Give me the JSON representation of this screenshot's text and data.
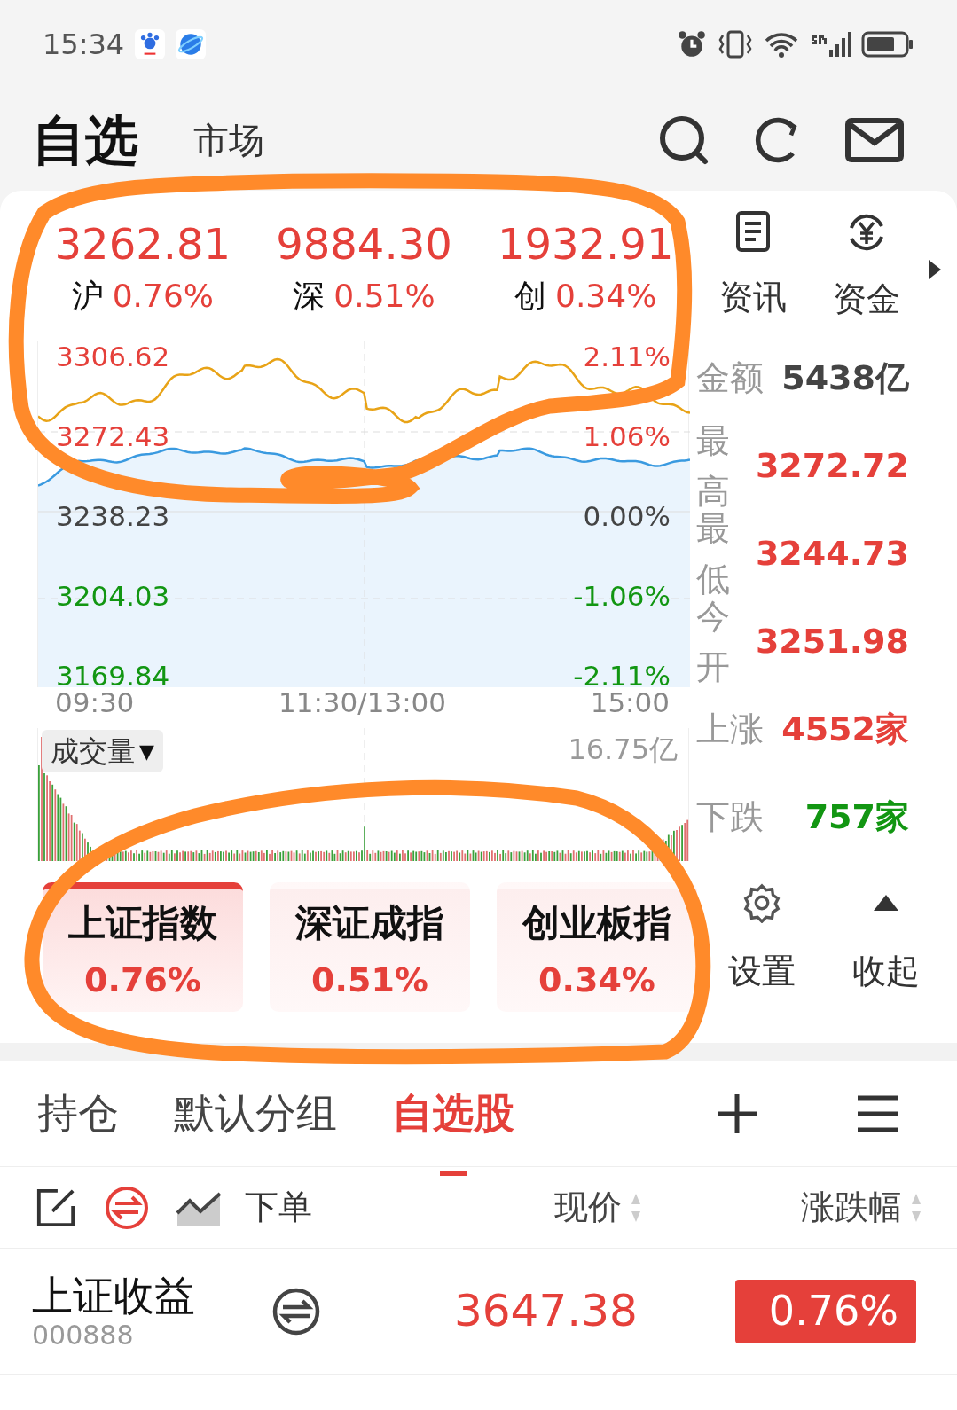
{
  "status_bar": {
    "time": "15:34"
  },
  "header": {
    "tabs": [
      {
        "label": "自选",
        "selected": true
      },
      {
        "label": "市场",
        "selected": false
      }
    ]
  },
  "indices": [
    {
      "value": "3262.81",
      "name": "沪",
      "change": "0.76%"
    },
    {
      "value": "9884.30",
      "name": "深",
      "change": "0.51%"
    },
    {
      "value": "1932.91",
      "name": "创",
      "change": "0.34%"
    }
  ],
  "side_tabs": [
    {
      "label": "资讯",
      "kind": "news"
    },
    {
      "label": "资金",
      "kind": "money"
    }
  ],
  "chart": {
    "left_labels": [
      {
        "text": "3306.62",
        "kind": "up"
      },
      {
        "text": "3272.43",
        "kind": "up"
      },
      {
        "text": "3238.23",
        "kind": "flat"
      },
      {
        "text": "3204.03",
        "kind": "down"
      },
      {
        "text": "3169.84",
        "kind": "down"
      }
    ],
    "right_labels": [
      {
        "text": "2.11%",
        "kind": "up"
      },
      {
        "text": "1.06%",
        "kind": "up"
      },
      {
        "text": "0.00%",
        "kind": "flat"
      },
      {
        "text": "-1.06%",
        "kind": "down"
      },
      {
        "text": "-2.11%",
        "kind": "down"
      }
    ],
    "time_labels": [
      "09:30",
      "11:30/13:00",
      "15:00"
    ]
  },
  "volume": {
    "selector": "成交量",
    "caret": "▼",
    "max": "16.75亿"
  },
  "stats": [
    {
      "label": "金额",
      "value": "5438亿",
      "kind": "flat"
    },
    {
      "label": "最高",
      "value": "3272.72",
      "kind": "up"
    },
    {
      "label": "最低",
      "value": "3244.73",
      "kind": "up"
    },
    {
      "label": "今开",
      "value": "3251.98",
      "kind": "up"
    },
    {
      "label": "上涨",
      "value": "4552家",
      "kind": "up"
    },
    {
      "label": "下跌",
      "value": "757家",
      "kind": "down"
    }
  ],
  "index_cards": [
    {
      "name": "上证指数",
      "change": "0.76%",
      "selected": true
    },
    {
      "name": "深证成指",
      "change": "0.51%",
      "selected": false
    },
    {
      "name": "创业板指",
      "change": "0.34%",
      "selected": false
    }
  ],
  "card_actions": [
    {
      "label": "设置",
      "kind": "settings"
    },
    {
      "label": "收起",
      "kind": "collapse"
    }
  ],
  "groups": [
    {
      "label": "持仓",
      "selected": false
    },
    {
      "label": "默认分组",
      "selected": false
    },
    {
      "label": "自选股",
      "selected": true
    }
  ],
  "list_header": {
    "order": "下单",
    "columns": [
      "现价",
      "涨跌幅"
    ]
  },
  "rows": [
    {
      "name": "上证收益",
      "code": "000888",
      "price": "3647.38",
      "change": "0.76%"
    }
  ]
}
